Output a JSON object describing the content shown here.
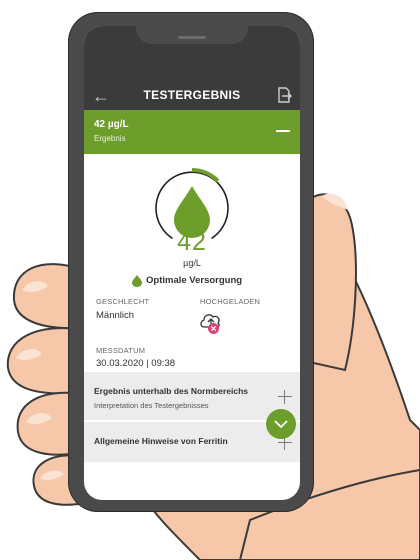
{
  "app": {
    "title": "TESTERGEBNIS",
    "back_icon": "arrow-left-icon",
    "share_icon": "share-export-icon"
  },
  "result": {
    "value": "42 µg/L",
    "label": "Ergebnis",
    "big_number": "42",
    "unit": "µg/L",
    "status": "Optimale Versorgung",
    "gauge_fraction": 0.17,
    "accent": "#6d9d2b"
  },
  "details": {
    "gender_label": "GESCHLECHT",
    "gender_value": "Männlich",
    "uploaded_label": "HOCHGELADEN",
    "measure_label": "MESSDATUM",
    "measure_value": "30.03.2020 | 09:38"
  },
  "sections": [
    {
      "title": "Ergebnis unterhalb des Normbereichs",
      "subtitle": "Interpretation des Testergebnisses"
    },
    {
      "title": "Allgemeine Hinweise von Ferritin"
    }
  ],
  "colors": {
    "header_dark": "#3b3b3b",
    "result_green": "#6d9d2b",
    "error_pink": "#d9437a"
  }
}
